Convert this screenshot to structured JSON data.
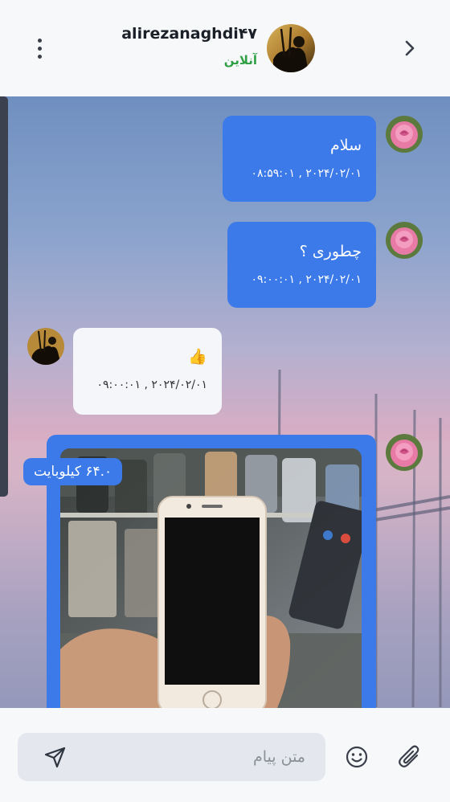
{
  "header": {
    "username": "alirezanaghdi۴۷",
    "status": "آنلاین"
  },
  "messages": [
    {
      "direction": "out",
      "text": "سلام",
      "time": "۲۰۲۴/۰۲/۰۱ , ۰۸:۵۹:۰۱"
    },
    {
      "direction": "out",
      "text": "چطوری ؟",
      "time": "۲۰۲۴/۰۲/۰۱ , ۰۹:۰۰:۰۱"
    },
    {
      "direction": "in",
      "text": "👍",
      "time": "۲۰۲۴/۰۲/۰۱ , ۰۹:۰۰:۰۱"
    },
    {
      "direction": "out",
      "type": "image",
      "file_size": "۶۴.۰ کیلوبایت"
    }
  ],
  "composer": {
    "placeholder": "متن پیام",
    "value": ""
  },
  "icons": {
    "back": "chevron-right-icon",
    "menu": "more-vertical-icon",
    "send": "send-icon",
    "emoji": "smile-icon",
    "attach": "paperclip-icon"
  },
  "colors": {
    "outgoing_bubble": "#3b7ae8",
    "incoming_bubble": "#f4f6f9",
    "online_status": "#2ea043"
  }
}
